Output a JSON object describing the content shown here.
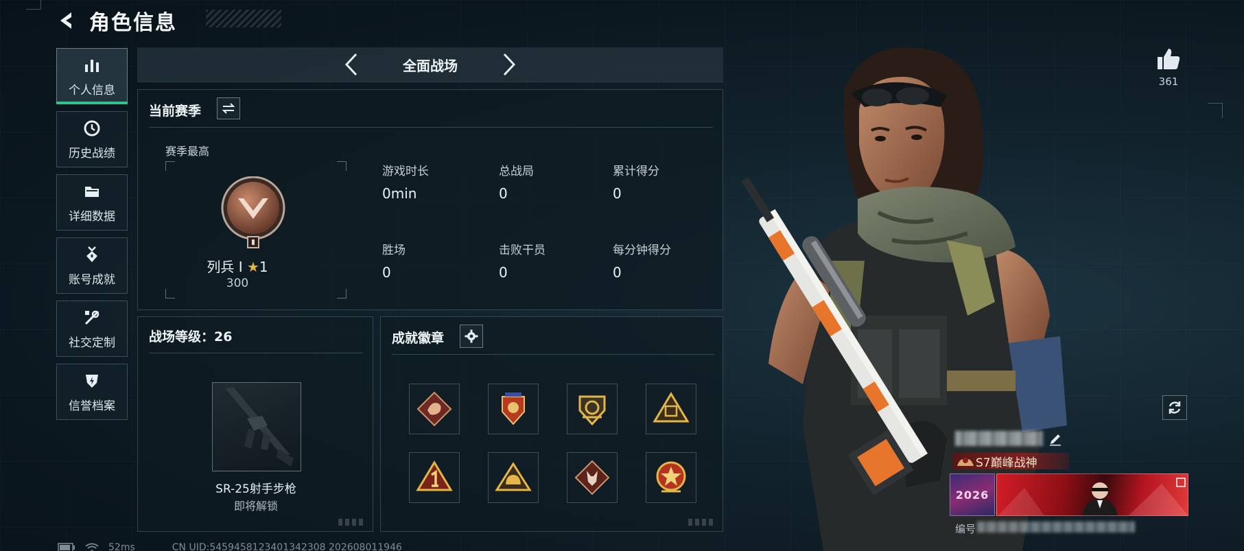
{
  "header": {
    "title": "角色信息"
  },
  "sidebar": {
    "items": [
      {
        "label": "个人信息",
        "icon": "bar-chart-icon",
        "active": true
      },
      {
        "label": "历史战绩",
        "icon": "clock-icon",
        "active": false
      },
      {
        "label": "详细数据",
        "icon": "folder-icon",
        "active": false
      },
      {
        "label": "账号成就",
        "icon": "medal-icon",
        "active": false
      },
      {
        "label": "社交定制",
        "icon": "tools-icon",
        "active": false
      },
      {
        "label": "信誉档案",
        "icon": "shield-icon",
        "active": false
      }
    ]
  },
  "mode": {
    "label": "全面战场"
  },
  "season": {
    "title": "当前赛季",
    "best_label": "赛季最高",
    "rank_name": "列兵 I",
    "rank_stars": "1",
    "rank_score": "300",
    "stats": [
      {
        "label": "游戏时长",
        "value": "0min"
      },
      {
        "label": "总战局",
        "value": "0"
      },
      {
        "label": "累计得分",
        "value": "0"
      },
      {
        "label": "胜场",
        "value": "0"
      },
      {
        "label": "击败干员",
        "value": "0"
      },
      {
        "label": "每分钟得分",
        "value": "0"
      }
    ]
  },
  "level": {
    "title": "战场等级：26",
    "weapon_name": "SR-25射手步枪",
    "weapon_status": "即将解锁"
  },
  "badges": {
    "title": "成就徽章",
    "items": [
      "dragon-badge-icon",
      "shield-badge-icon",
      "crest-badge-icon",
      "pyramid-badge-icon",
      "number-one-badge-icon",
      "helmet-badge-icon",
      "wolf-badge-icon",
      "star-badge-icon"
    ]
  },
  "profile": {
    "likes": "361",
    "player_title": "S7巅峰战神",
    "card_text": "2026",
    "id_label": "编号"
  },
  "footer": {
    "ping": "52ms",
    "uid": "CN UID:5459458123401342308 202608011946"
  },
  "colors": {
    "accent": "#2ec28e",
    "gold": "#e2b945",
    "banner_red": "#c91f2a"
  }
}
